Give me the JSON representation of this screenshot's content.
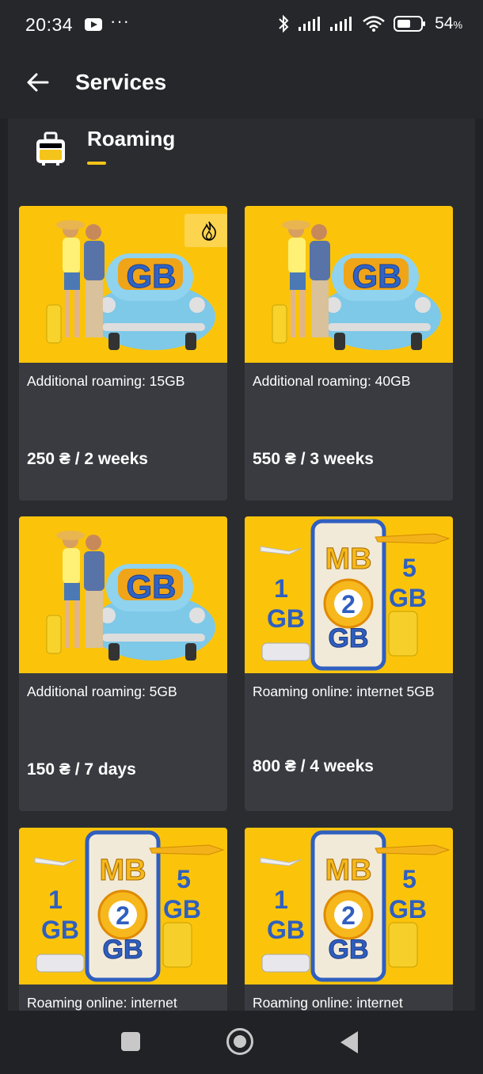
{
  "status": {
    "time": "20:34",
    "battery_pct": "54",
    "battery_unit": "%"
  },
  "appbar": {
    "title": "Services"
  },
  "section": {
    "title": "Roaming"
  },
  "cards": [
    {
      "name": "Additional roaming: 15GB",
      "price": "250 ₴ / 2 weeks",
      "image": "car-couple",
      "hot": true
    },
    {
      "name": "Additional roaming: 40GB",
      "price": "550 ₴ / 3 weeks",
      "image": "car-couple"
    },
    {
      "name": "Additional roaming: 5GB",
      "price": "150 ₴ / 7 days",
      "image": "car-couple"
    },
    {
      "name": "Roaming online: internet 5GB",
      "price": "800 ₴ / 4 weeks",
      "image": "phone-gb"
    },
    {
      "name": "Roaming online: internet",
      "price": "",
      "image": "phone-gb"
    },
    {
      "name": "Roaming online: internet",
      "price": "",
      "image": "phone-gb"
    }
  ],
  "image_text": {
    "car_badge": "GB",
    "phone_top": "MB",
    "phone_mid": "2",
    "phone_bottom": "GB",
    "left_num": "1",
    "left_unit": "GB",
    "right_num": "5",
    "right_unit": "GB"
  },
  "colors": {
    "accent": "#f5c41a",
    "card_bg": "#393b40",
    "image_bg": "#fbc40b"
  },
  "icons": {
    "back": "arrow-left-icon",
    "section": "suitcase-icon",
    "hot": "fire-icon"
  }
}
